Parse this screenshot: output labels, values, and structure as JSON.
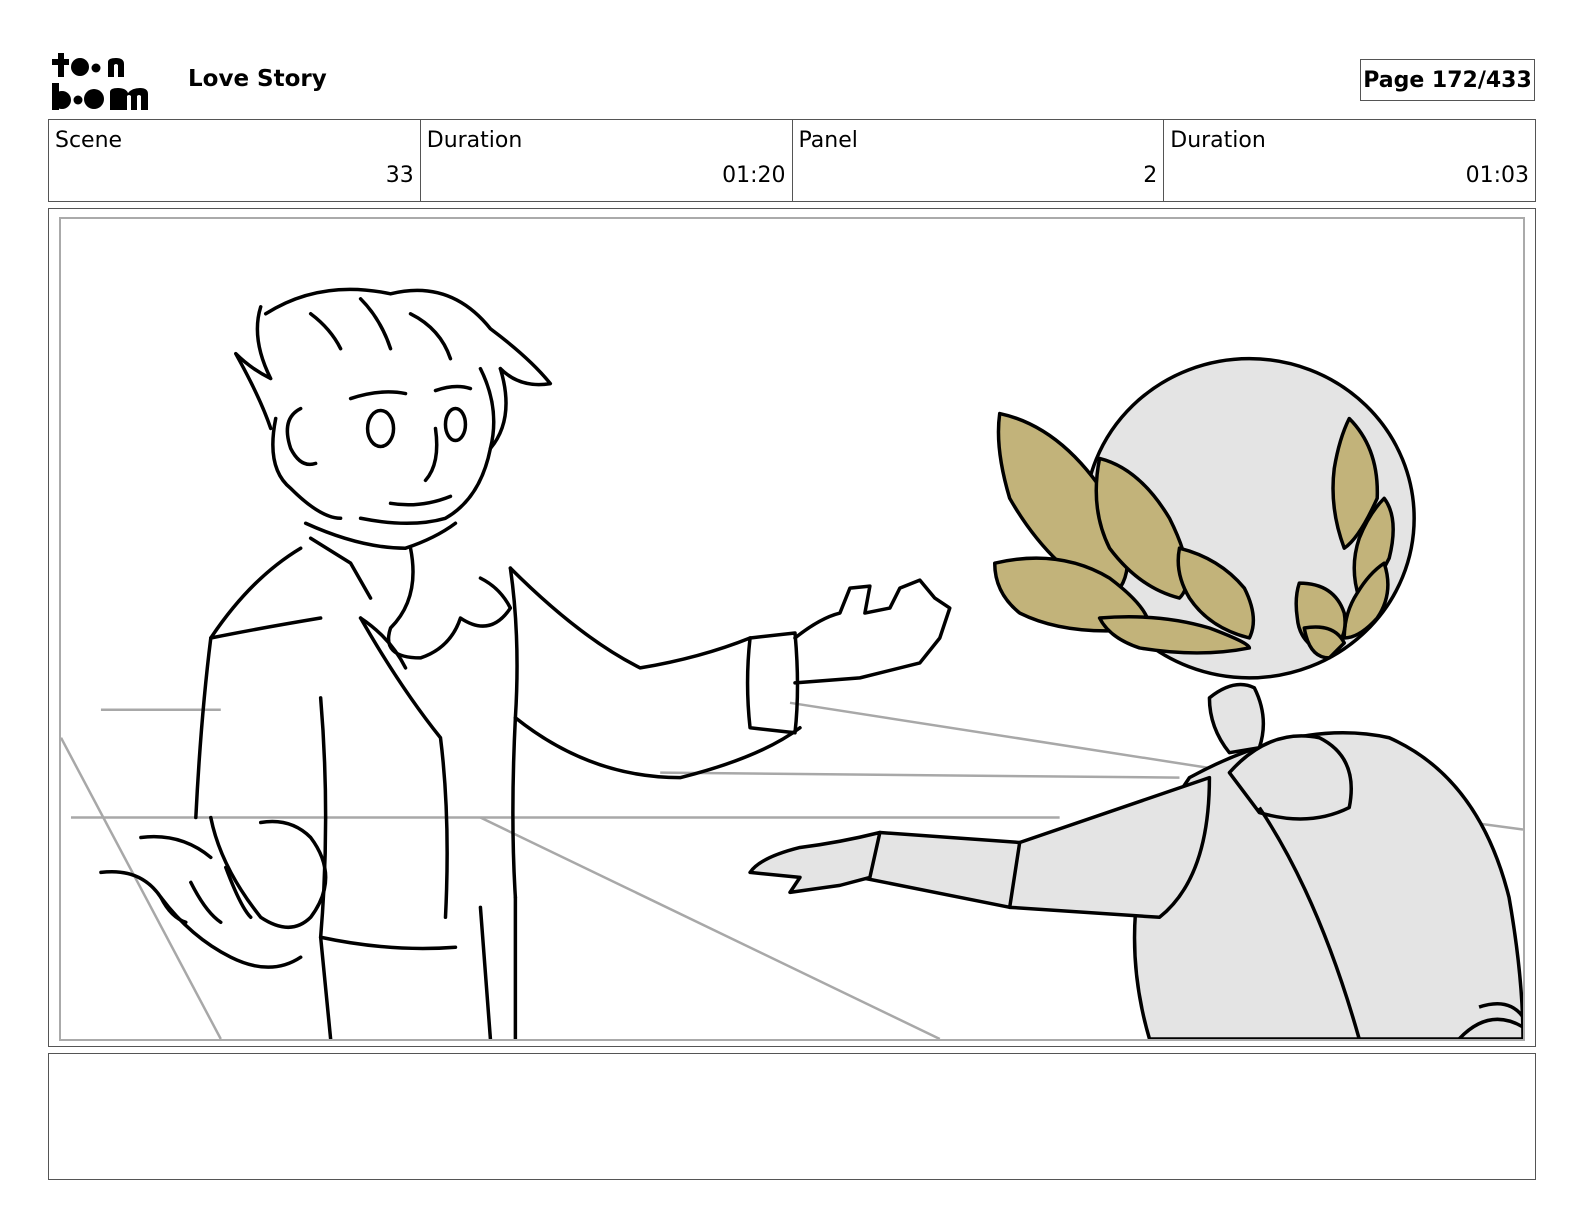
{
  "header": {
    "logo_alt": "toon boom",
    "project_title": "Love Story",
    "page_label": "Page 172/433"
  },
  "info": {
    "scene_label": "Scene",
    "scene_value": "33",
    "scene_duration_label": "Duration",
    "scene_duration_value": "01:20",
    "panel_label": "Panel",
    "panel_value": "2",
    "panel_duration_label": "Duration",
    "panel_duration_value": "01:03"
  },
  "colors": {
    "laurel": "#c2b37a",
    "mannequin": "#e4e4e4",
    "guide_lines": "#a8a8a8"
  },
  "notes": ""
}
